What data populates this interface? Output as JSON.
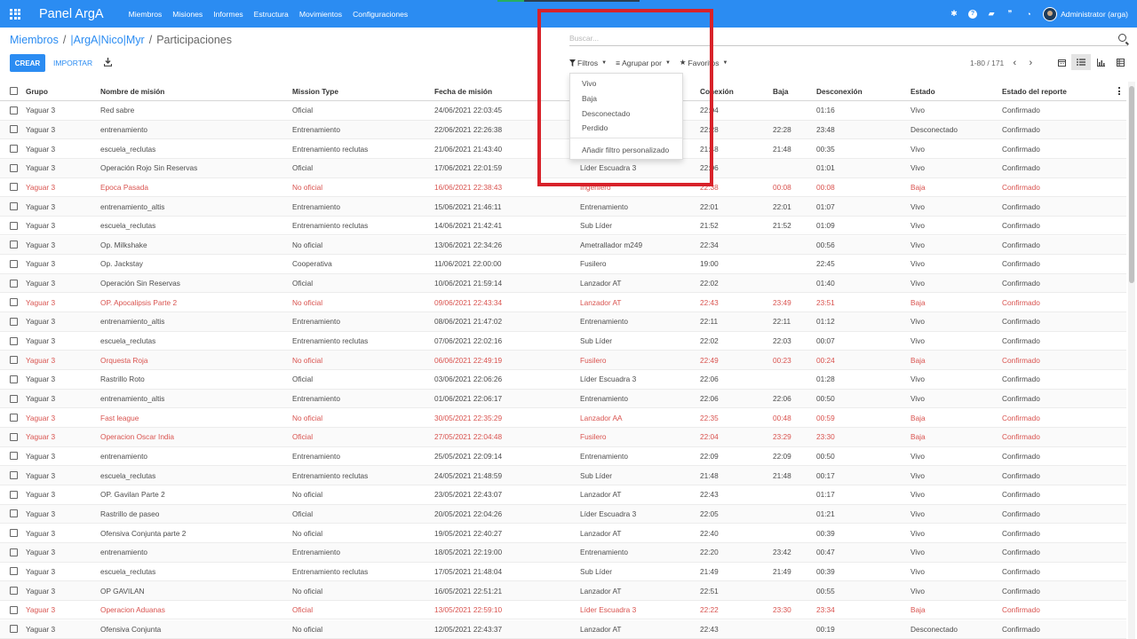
{
  "navbar": {
    "brand": "Panel ArgA",
    "menu": [
      "Miembros",
      "Misiones",
      "Informes",
      "Estructura",
      "Movimientos",
      "Configuraciones"
    ],
    "user": "Administrator (arga)"
  },
  "breadcrumb": [
    "Miembros",
    "/",
    "|ArgA|Nico|Myr",
    "/",
    "Participaciones"
  ],
  "search": {
    "placeholder": "Buscar..."
  },
  "buttons": {
    "create": "CREAR",
    "import": "IMPORTAR"
  },
  "filterbar": {
    "filters": "Filtros",
    "group_by": "Agrupar por",
    "favorites": "Favoritos"
  },
  "pager": "1-80 / 171",
  "dropdown": {
    "options": [
      "Vivo",
      "Baja",
      "Desconectado",
      "Perdido"
    ],
    "custom": "Añadir filtro personalizado"
  },
  "columns": [
    "Grupo",
    "Nombre de misión",
    "Mission Type",
    "Fecha de misión",
    "",
    "Conexión",
    "Baja",
    "Desconexión",
    "Estado",
    "Estado del reporte"
  ],
  "rows": [
    {
      "grupo": "Yaguar 3",
      "mision": "Red sabre",
      "tipo": "Oficial",
      "fecha": "24/06/2021 22:03:45",
      "rol": "",
      "con": "22:04",
      "baja": "",
      "desc": "01:16",
      "estado": "Vivo",
      "reporte": "Confirmado",
      "red": false
    },
    {
      "grupo": "Yaguar 3",
      "mision": "entrenamiento",
      "tipo": "Entrenamiento",
      "fecha": "22/06/2021 22:26:38",
      "rol": "",
      "con": "22:28",
      "baja": "22:28",
      "desc": "23:48",
      "estado": "Desconectado",
      "reporte": "Confirmado",
      "red": false
    },
    {
      "grupo": "Yaguar 3",
      "mision": "escuela_reclutas",
      "tipo": "Entrenamiento reclutas",
      "fecha": "21/06/2021 21:43:40",
      "rol": "",
      "con": "21:48",
      "baja": "21:48",
      "desc": "00:35",
      "estado": "Vivo",
      "reporte": "Confirmado",
      "red": false
    },
    {
      "grupo": "Yaguar 3",
      "mision": "Operación Rojo Sin Reservas",
      "tipo": "Oficial",
      "fecha": "17/06/2021 22:01:59",
      "rol": "Líder Escuadra 3",
      "con": "22:06",
      "baja": "",
      "desc": "01:01",
      "estado": "Vivo",
      "reporte": "Confirmado",
      "red": false
    },
    {
      "grupo": "Yaguar 3",
      "mision": "Epoca Pasada",
      "tipo": "No oficial",
      "fecha": "16/06/2021 22:38:43",
      "rol": "Ingeniero",
      "con": "22:38",
      "baja": "00:08",
      "desc": "00:08",
      "estado": "Baja",
      "reporte": "Confirmado",
      "red": true
    },
    {
      "grupo": "Yaguar 3",
      "mision": "entrenamiento_altis",
      "tipo": "Entrenamiento",
      "fecha": "15/06/2021 21:46:11",
      "rol": "Entrenamiento",
      "con": "22:01",
      "baja": "22:01",
      "desc": "01:07",
      "estado": "Vivo",
      "reporte": "Confirmado",
      "red": false
    },
    {
      "grupo": "Yaguar 3",
      "mision": "escuela_reclutas",
      "tipo": "Entrenamiento reclutas",
      "fecha": "14/06/2021 21:42:41",
      "rol": "Sub Líder",
      "con": "21:52",
      "baja": "21:52",
      "desc": "01:09",
      "estado": "Vivo",
      "reporte": "Confirmado",
      "red": false
    },
    {
      "grupo": "Yaguar 3",
      "mision": "Op. Milkshake",
      "tipo": "No oficial",
      "fecha": "13/06/2021 22:34:26",
      "rol": "Ametrallador m249",
      "con": "22:34",
      "baja": "",
      "desc": "00:56",
      "estado": "Vivo",
      "reporte": "Confirmado",
      "red": false
    },
    {
      "grupo": "Yaguar 3",
      "mision": "Op. Jackstay",
      "tipo": "Cooperativa",
      "fecha": "11/06/2021 22:00:00",
      "rol": "Fusilero",
      "con": "19:00",
      "baja": "",
      "desc": "22:45",
      "estado": "Vivo",
      "reporte": "Confirmado",
      "red": false
    },
    {
      "grupo": "Yaguar 3",
      "mision": "Operación Sin Reservas",
      "tipo": "Oficial",
      "fecha": "10/06/2021 21:59:14",
      "rol": "Lanzador AT",
      "con": "22:02",
      "baja": "",
      "desc": "01:40",
      "estado": "Vivo",
      "reporte": "Confirmado",
      "red": false
    },
    {
      "grupo": "Yaguar 3",
      "mision": "OP. Apocalipsis Parte 2",
      "tipo": "No oficial",
      "fecha": "09/06/2021 22:43:34",
      "rol": "Lanzador AT",
      "con": "22:43",
      "baja": "23:49",
      "desc": "23:51",
      "estado": "Baja",
      "reporte": "Confirmado",
      "red": true
    },
    {
      "grupo": "Yaguar 3",
      "mision": "entrenamiento_altis",
      "tipo": "Entrenamiento",
      "fecha": "08/06/2021 21:47:02",
      "rol": "Entrenamiento",
      "con": "22:11",
      "baja": "22:11",
      "desc": "01:12",
      "estado": "Vivo",
      "reporte": "Confirmado",
      "red": false
    },
    {
      "grupo": "Yaguar 3",
      "mision": "escuela_reclutas",
      "tipo": "Entrenamiento reclutas",
      "fecha": "07/06/2021 22:02:16",
      "rol": "Sub Líder",
      "con": "22:02",
      "baja": "22:03",
      "desc": "00:07",
      "estado": "Vivo",
      "reporte": "Confirmado",
      "red": false
    },
    {
      "grupo": "Yaguar 3",
      "mision": "Orquesta Roja",
      "tipo": "No oficial",
      "fecha": "06/06/2021 22:49:19",
      "rol": "Fusilero",
      "con": "22:49",
      "baja": "00:23",
      "desc": "00:24",
      "estado": "Baja",
      "reporte": "Confirmado",
      "red": true
    },
    {
      "grupo": "Yaguar 3",
      "mision": "Rastrillo Roto",
      "tipo": "Oficial",
      "fecha": "03/06/2021 22:06:26",
      "rol": "Líder Escuadra 3",
      "con": "22:06",
      "baja": "",
      "desc": "01:28",
      "estado": "Vivo",
      "reporte": "Confirmado",
      "red": false
    },
    {
      "grupo": "Yaguar 3",
      "mision": "entrenamiento_altis",
      "tipo": "Entrenamiento",
      "fecha": "01/06/2021 22:06:17",
      "rol": "Entrenamiento",
      "con": "22:06",
      "baja": "22:06",
      "desc": "00:50",
      "estado": "Vivo",
      "reporte": "Confirmado",
      "red": false
    },
    {
      "grupo": "Yaguar 3",
      "mision": "Fast league",
      "tipo": "No oficial",
      "fecha": "30/05/2021 22:35:29",
      "rol": "Lanzador AA",
      "con": "22:35",
      "baja": "00:48",
      "desc": "00:59",
      "estado": "Baja",
      "reporte": "Confirmado",
      "red": true
    },
    {
      "grupo": "Yaguar 3",
      "mision": "Operacion Oscar India",
      "tipo": "Oficial",
      "fecha": "27/05/2021 22:04:48",
      "rol": "Fusilero",
      "con": "22:04",
      "baja": "23:29",
      "desc": "23:30",
      "estado": "Baja",
      "reporte": "Confirmado",
      "red": true
    },
    {
      "grupo": "Yaguar 3",
      "mision": "entrenamiento",
      "tipo": "Entrenamiento",
      "fecha": "25/05/2021 22:09:14",
      "rol": "Entrenamiento",
      "con": "22:09",
      "baja": "22:09",
      "desc": "00:50",
      "estado": "Vivo",
      "reporte": "Confirmado",
      "red": false
    },
    {
      "grupo": "Yaguar 3",
      "mision": "escuela_reclutas",
      "tipo": "Entrenamiento reclutas",
      "fecha": "24/05/2021 21:48:59",
      "rol": "Sub Líder",
      "con": "21:48",
      "baja": "21:48",
      "desc": "00:17",
      "estado": "Vivo",
      "reporte": "Confirmado",
      "red": false
    },
    {
      "grupo": "Yaguar 3",
      "mision": "OP. Gavilan Parte 2",
      "tipo": "No oficial",
      "fecha": "23/05/2021 22:43:07",
      "rol": "Lanzador AT",
      "con": "22:43",
      "baja": "",
      "desc": "01:17",
      "estado": "Vivo",
      "reporte": "Confirmado",
      "red": false
    },
    {
      "grupo": "Yaguar 3",
      "mision": "Rastrillo de paseo",
      "tipo": "Oficial",
      "fecha": "20/05/2021 22:04:26",
      "rol": "Líder Escuadra 3",
      "con": "22:05",
      "baja": "",
      "desc": "01:21",
      "estado": "Vivo",
      "reporte": "Confirmado",
      "red": false
    },
    {
      "grupo": "Yaguar 3",
      "mision": "Ofensiva Conjunta parte 2",
      "tipo": "No oficial",
      "fecha": "19/05/2021 22:40:27",
      "rol": "Lanzador AT",
      "con": "22:40",
      "baja": "",
      "desc": "00:39",
      "estado": "Vivo",
      "reporte": "Confirmado",
      "red": false
    },
    {
      "grupo": "Yaguar 3",
      "mision": "entrenamiento",
      "tipo": "Entrenamiento",
      "fecha": "18/05/2021 22:19:00",
      "rol": "Entrenamiento",
      "con": "22:20",
      "baja": "23:42",
      "desc": "00:47",
      "estado": "Vivo",
      "reporte": "Confirmado",
      "red": false
    },
    {
      "grupo": "Yaguar 3",
      "mision": "escuela_reclutas",
      "tipo": "Entrenamiento reclutas",
      "fecha": "17/05/2021 21:48:04",
      "rol": "Sub Líder",
      "con": "21:49",
      "baja": "21:49",
      "desc": "00:39",
      "estado": "Vivo",
      "reporte": "Confirmado",
      "red": false
    },
    {
      "grupo": "Yaguar 3",
      "mision": "OP GAVILAN",
      "tipo": "No oficial",
      "fecha": "16/05/2021 22:51:21",
      "rol": "Lanzador AT",
      "con": "22:51",
      "baja": "",
      "desc": "00:55",
      "estado": "Vivo",
      "reporte": "Confirmado",
      "red": false
    },
    {
      "grupo": "Yaguar 3",
      "mision": "Operacion Aduanas",
      "tipo": "Oficial",
      "fecha": "13/05/2021 22:59:10",
      "rol": "Líder Escuadra 3",
      "con": "22:22",
      "baja": "23:30",
      "desc": "23:34",
      "estado": "Baja",
      "reporte": "Confirmado",
      "red": true
    },
    {
      "grupo": "Yaguar 3",
      "mision": "Ofensiva Conjunta",
      "tipo": "No oficial",
      "fecha": "12/05/2021 22:43:37",
      "rol": "Lanzador AT",
      "con": "22:43",
      "baja": "",
      "desc": "00:19",
      "estado": "Desconectado",
      "reporte": "Confirmado",
      "red": false
    }
  ]
}
